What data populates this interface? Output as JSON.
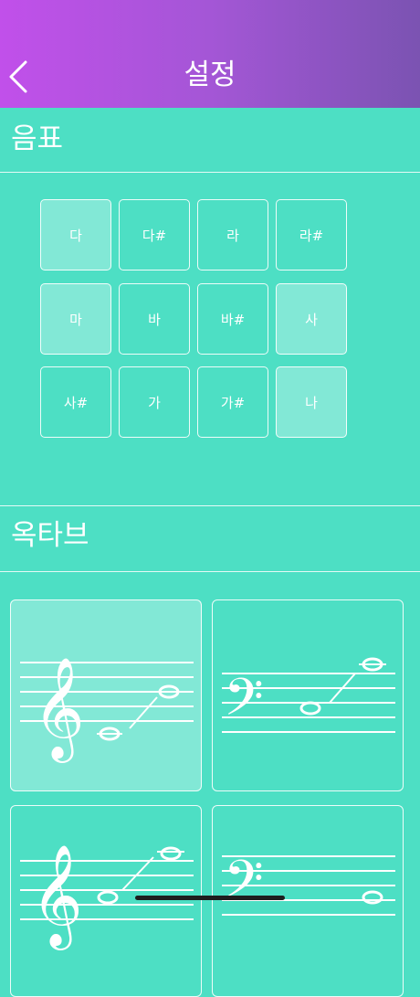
{
  "header": {
    "title": "설정",
    "back_icon": "chevron-left-icon"
  },
  "notes_section": {
    "title": "음표",
    "notes": [
      {
        "label": "다",
        "selected": true
      },
      {
        "label": "다#",
        "selected": false
      },
      {
        "label": "라",
        "selected": false
      },
      {
        "label": "라#",
        "selected": false
      },
      {
        "label": "마",
        "selected": true
      },
      {
        "label": "바",
        "selected": false
      },
      {
        "label": "바#",
        "selected": false
      },
      {
        "label": "사",
        "selected": true
      },
      {
        "label": "사#",
        "selected": false
      },
      {
        "label": "가",
        "selected": false
      },
      {
        "label": "가#",
        "selected": false
      },
      {
        "label": "나",
        "selected": true
      }
    ]
  },
  "octave_section": {
    "title": "옥타브",
    "options": [
      {
        "clef": "treble-clef-icon",
        "selected": true
      },
      {
        "clef": "bass-clef-icon",
        "selected": false
      },
      {
        "clef": "treble-clef-icon",
        "selected": false
      },
      {
        "clef": "bass-clef-icon",
        "selected": false
      }
    ]
  },
  "colors": {
    "background": "#4ddfc4",
    "header_start": "#c150ea",
    "header_end": "#7b53b2"
  }
}
